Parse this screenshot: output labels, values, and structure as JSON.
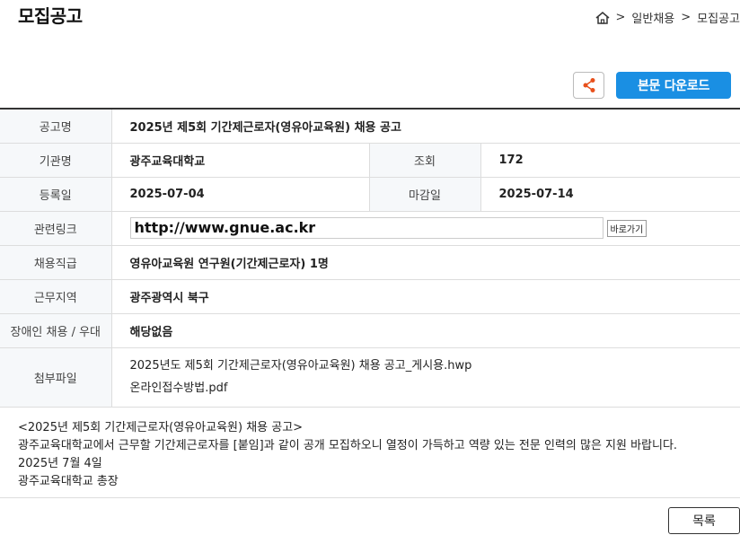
{
  "page": {
    "title": "모집공고"
  },
  "breadcrumb": {
    "items": [
      "일반채용",
      "모집공고"
    ],
    "separator": ">"
  },
  "actions": {
    "download_label": "본문 다운로드",
    "share_icon": "share-icon",
    "accent": "#1a8fe3"
  },
  "post": {
    "title_label": "공고명",
    "title": "2025년 제5회 기간제근로자(영유아교육원) 채용 공고",
    "org_label": "기관명",
    "org": "광주교육대학교",
    "views_label": "조회",
    "views": "172",
    "reg_label": "등록일",
    "reg_date": "2025-07-04",
    "deadline_label": "마감일",
    "deadline": "2025-07-14",
    "link_label": "관련링크",
    "link": "http://www.gnue.ac.kr",
    "go_label": "바로가기",
    "job_label": "채용직급",
    "job": "영유아교육원 연구원(기간제근로자) 1명",
    "region_label": "근무지역",
    "region": "광주광역시 북구",
    "disabled_label": "장애인 채용 / 우대",
    "disabled": "해당없음",
    "files_label": "첨부파일",
    "files": [
      "2025년도 제5회 기간제근로자(영유아교육원) 채용 공고_게시용.hwp",
      "온라인접수방법.pdf"
    ]
  },
  "body": {
    "lines": [
      "<2025년 제5회 기간제근로자(영유아교육원) 채용 공고>",
      " 광주교육대학교에서 근무할 기간제근로자를 [붙임]과 같이 공개 모집하오니 열정이 가득하고 역량 있는 전문 인력의 많은 지원 바랍니다.",
      "2025년 7월 4일",
      "광주교육대학교 총장"
    ]
  },
  "footer": {
    "list_label": "목록"
  }
}
